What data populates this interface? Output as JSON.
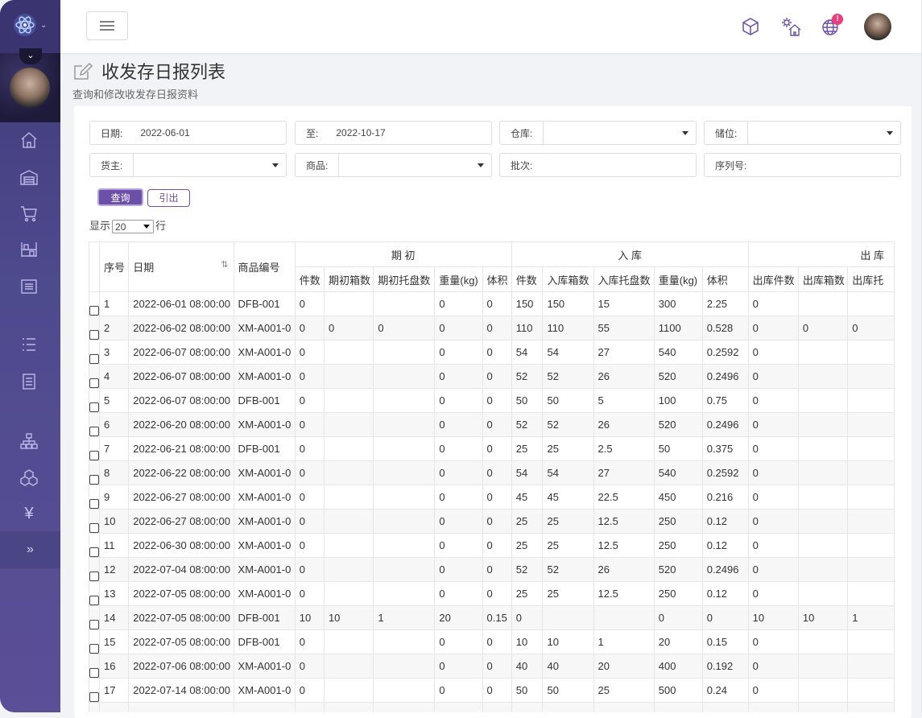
{
  "app": {
    "brand_icon": "atom-logo-icon"
  },
  "sidebar": {
    "items": [
      {
        "name": "home-icon"
      },
      {
        "name": "warehouse-icon"
      },
      {
        "name": "cart-icon"
      },
      {
        "name": "shelves-icon"
      },
      {
        "name": "list-icon"
      },
      {
        "name": "list-lines-icon"
      },
      {
        "name": "document-icon"
      },
      {
        "name": "org-chart-icon"
      },
      {
        "name": "boxes-icon"
      },
      {
        "name": "yen-icon",
        "glyph": "¥"
      }
    ],
    "expand_glyph": "»"
  },
  "topbar": {
    "icons": [
      "cube-icon",
      "settings-home-icon",
      "globe-icon"
    ],
    "notification_badge": "!"
  },
  "page": {
    "title": "收发存日报列表",
    "subtitle": "查询和修改收发存日报资料"
  },
  "filters": {
    "date_label": "日期:",
    "date_from": "2022-06-01",
    "to_label": "至:",
    "date_to": "2022-10-17",
    "warehouse_label": "仓库:",
    "location_label": "储位:",
    "owner_label": "货主:",
    "product_label": "商品:",
    "batch_label": "批次:",
    "serial_label": "序列号:"
  },
  "buttons": {
    "query": "查询",
    "export": "引出"
  },
  "pager": {
    "show": "显示",
    "page_size": "20",
    "rows": "行"
  },
  "table": {
    "headers": {
      "seq": "序号",
      "date": "日期",
      "code": "商品编号",
      "group_opening": "期 初",
      "group_in": "入 库",
      "group_out": "出 库"
    },
    "sub_headers": {
      "opening": [
        "件数",
        "期初箱数",
        "期初托盘数",
        "重量(kg)",
        "体积"
      ],
      "in": [
        "件数",
        "入库箱数",
        "入库托盘数",
        "重量(kg)",
        "体积"
      ],
      "out": [
        "出库件数",
        "出库箱数",
        "出库托"
      ]
    },
    "rows": [
      [
        "1",
        "2022-06-01 08:00:00",
        "DFB-001",
        "0",
        "",
        "",
        "0",
        "0",
        "150",
        "150",
        "15",
        "300",
        "2.25",
        "0",
        "",
        ""
      ],
      [
        "2",
        "2022-06-02 08:00:00",
        "XM-A001-0",
        "0",
        "0",
        "0",
        "0",
        "0",
        "110",
        "110",
        "55",
        "1100",
        "0.528",
        "0",
        "0",
        "0"
      ],
      [
        "3",
        "2022-06-07 08:00:00",
        "XM-A001-0",
        "0",
        "",
        "",
        "0",
        "0",
        "54",
        "54",
        "27",
        "540",
        "0.2592",
        "0",
        "",
        ""
      ],
      [
        "4",
        "2022-06-07 08:00:00",
        "XM-A001-0",
        "0",
        "",
        "",
        "0",
        "0",
        "52",
        "52",
        "26",
        "520",
        "0.2496",
        "0",
        "",
        ""
      ],
      [
        "5",
        "2022-06-07 08:00:00",
        "DFB-001",
        "0",
        "",
        "",
        "0",
        "0",
        "50",
        "50",
        "5",
        "100",
        "0.75",
        "0",
        "",
        ""
      ],
      [
        "6",
        "2022-06-20 08:00:00",
        "XM-A001-0",
        "0",
        "",
        "",
        "0",
        "0",
        "52",
        "52",
        "26",
        "520",
        "0.2496",
        "0",
        "",
        ""
      ],
      [
        "7",
        "2022-06-21 08:00:00",
        "DFB-001",
        "0",
        "",
        "",
        "0",
        "0",
        "25",
        "25",
        "2.5",
        "50",
        "0.375",
        "0",
        "",
        ""
      ],
      [
        "8",
        "2022-06-22 08:00:00",
        "XM-A001-0",
        "0",
        "",
        "",
        "0",
        "0",
        "54",
        "54",
        "27",
        "540",
        "0.2592",
        "0",
        "",
        ""
      ],
      [
        "9",
        "2022-06-27 08:00:00",
        "XM-A001-0",
        "0",
        "",
        "",
        "0",
        "0",
        "45",
        "45",
        "22.5",
        "450",
        "0.216",
        "0",
        "",
        ""
      ],
      [
        "10",
        "2022-06-27 08:00:00",
        "XM-A001-0",
        "0",
        "",
        "",
        "0",
        "0",
        "25",
        "25",
        "12.5",
        "250",
        "0.12",
        "0",
        "",
        ""
      ],
      [
        "11",
        "2022-06-30 08:00:00",
        "XM-A001-0",
        "0",
        "",
        "",
        "0",
        "0",
        "25",
        "25",
        "12.5",
        "250",
        "0.12",
        "0",
        "",
        ""
      ],
      [
        "12",
        "2022-07-04 08:00:00",
        "XM-A001-0",
        "0",
        "",
        "",
        "0",
        "0",
        "52",
        "52",
        "26",
        "520",
        "0.2496",
        "0",
        "",
        ""
      ],
      [
        "13",
        "2022-07-05 08:00:00",
        "XM-A001-0",
        "0",
        "",
        "",
        "0",
        "0",
        "25",
        "25",
        "12.5",
        "250",
        "0.12",
        "0",
        "",
        ""
      ],
      [
        "14",
        "2022-07-05 08:00:00",
        "DFB-001",
        "10",
        "10",
        "1",
        "20",
        "0.15",
        "0",
        "",
        "",
        "0",
        "0",
        "10",
        "10",
        "1"
      ],
      [
        "15",
        "2022-07-05 08:00:00",
        "DFB-001",
        "0",
        "",
        "",
        "0",
        "0",
        "10",
        "10",
        "1",
        "20",
        "0.15",
        "0",
        "",
        ""
      ],
      [
        "16",
        "2022-07-06 08:00:00",
        "XM-A001-0",
        "0",
        "",
        "",
        "0",
        "0",
        "40",
        "40",
        "20",
        "400",
        "0.192",
        "0",
        "",
        ""
      ],
      [
        "17",
        "2022-07-14 08:00:00",
        "XM-A001-0",
        "0",
        "",
        "",
        "0",
        "0",
        "50",
        "50",
        "25",
        "500",
        "0.24",
        "0",
        "",
        ""
      ],
      [
        "",
        "",
        "",
        "",
        "",
        "",
        "",
        "",
        "",
        "",
        "",
        "",
        "",
        "",
        "",
        ""
      ]
    ]
  },
  "colors": {
    "primary": "#6c4fa7",
    "sidebar": "#4e4a8e",
    "badge": "#ee3d7a"
  }
}
